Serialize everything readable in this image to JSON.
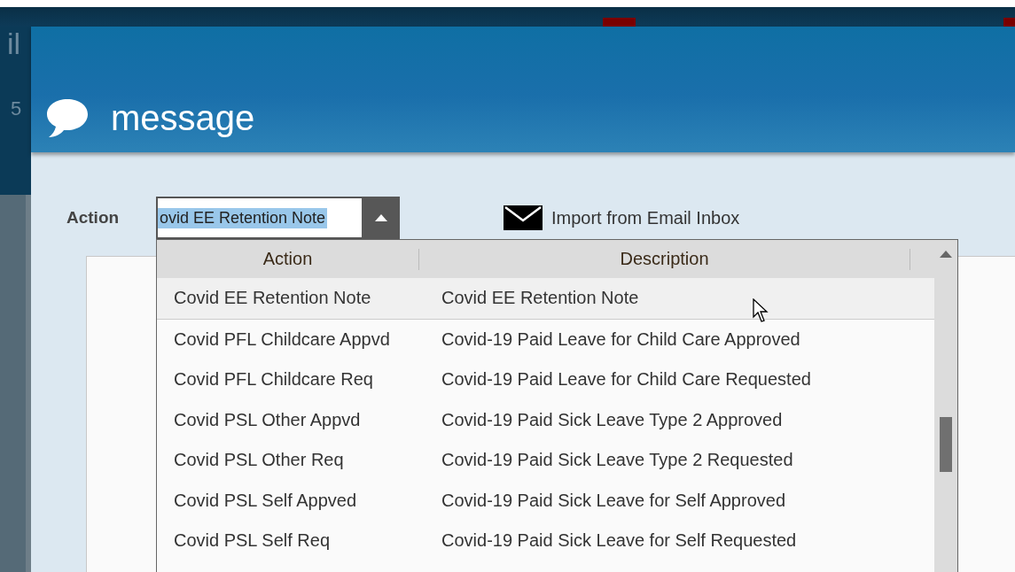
{
  "background_app": {
    "fragments": [
      "il",
      "5"
    ]
  },
  "dialog": {
    "title": "message",
    "action_field": {
      "label": "Action",
      "value": "ovid EE Retention Note",
      "text_selected": true,
      "expanded": true
    },
    "import_link": "Import from Email Inbox",
    "dropdown": {
      "columns": [
        "Action",
        "Description"
      ],
      "rows": [
        {
          "action": "Covid EE Retention Note",
          "description": "Covid EE Retention Note",
          "selected": true
        },
        {
          "action": "Covid PFL Childcare Appvd",
          "description": "Covid-19 Paid Leave for Child Care Approved",
          "selected": false
        },
        {
          "action": "Covid PFL Childcare Req",
          "description": "Covid-19 Paid Leave for Child Care Requested",
          "selected": false
        },
        {
          "action": "Covid PSL Other Appvd",
          "description": "Covid-19 Paid Sick Leave Type 2 Approved",
          "selected": false
        },
        {
          "action": "Covid PSL Other Req",
          "description": "Covid-19 Paid Sick Leave Type 2 Requested",
          "selected": false
        },
        {
          "action": "Covid PSL Self Appved",
          "description": "Covid-19 Paid Sick Leave for Self Approved",
          "selected": false
        },
        {
          "action": "Covid PSL Self Req",
          "description": "Covid-19 Paid Sick Leave for Self Requested",
          "selected": false
        }
      ]
    }
  }
}
